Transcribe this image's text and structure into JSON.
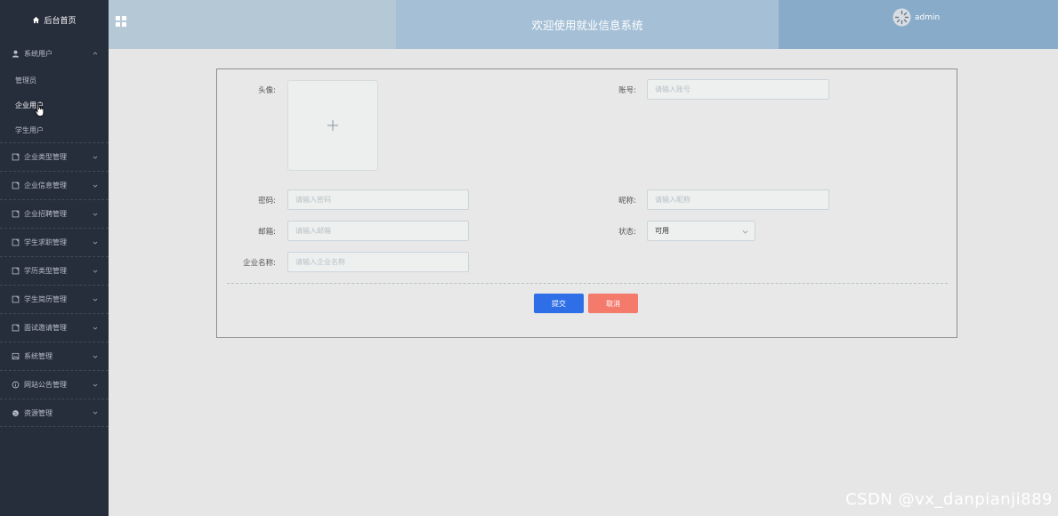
{
  "sidebar": {
    "home_label": "后台首页",
    "menus": [
      {
        "label": "系统用户",
        "icon": "user-icon",
        "expanded": true,
        "subitems": [
          "管理员",
          "企业用户",
          "学生用户"
        ]
      },
      {
        "label": "企业类型管理",
        "icon": "document-icon"
      },
      {
        "label": "企业信息管理",
        "icon": "document-icon"
      },
      {
        "label": "企业招聘管理",
        "icon": "document-icon"
      },
      {
        "label": "学生求职管理",
        "icon": "document-icon"
      },
      {
        "label": "学历类型管理",
        "icon": "document-icon"
      },
      {
        "label": "学生简历管理",
        "icon": "document-icon"
      },
      {
        "label": "面试邀请管理",
        "icon": "document-icon"
      },
      {
        "label": "系统管理",
        "icon": "image-icon"
      },
      {
        "label": "网站公告管理",
        "icon": "info-icon"
      },
      {
        "label": "资源管理",
        "icon": "globe-icon"
      }
    ]
  },
  "header": {
    "title": "欢迎使用就业信息系统",
    "user": "admin"
  },
  "form": {
    "avatar_label": "头像:",
    "account_label": "账号:",
    "account_placeholder": "请输入账号",
    "password_label": "密码:",
    "password_placeholder": "请输入密码",
    "nickname_label": "昵称:",
    "nickname_placeholder": "请输入昵称",
    "email_label": "邮箱:",
    "email_placeholder": "请输入邮箱",
    "status_label": "状态:",
    "status_value": "可用",
    "company_label": "企业名称:",
    "company_placeholder": "请输入企业名称",
    "submit_label": "提交",
    "cancel_label": "取消"
  },
  "colors": {
    "sidebar_bg": "#262d3b",
    "header_left": "#b5c8d6",
    "header_mid": "#a4bfd6",
    "header_right": "#87abc9",
    "submit": "#2e6ee7",
    "cancel": "#f47a6b"
  },
  "watermark": "CSDN @vx_danpianji889"
}
